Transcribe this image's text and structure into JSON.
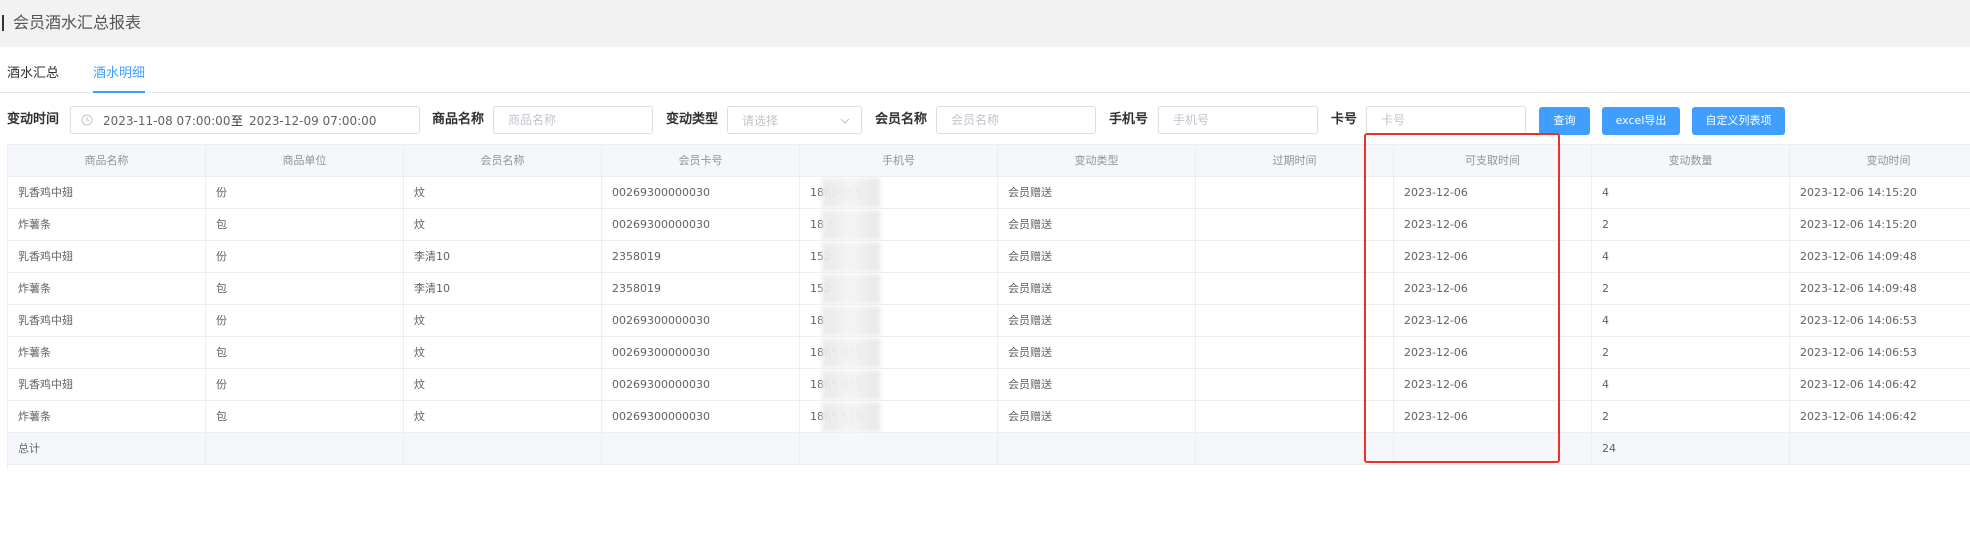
{
  "page": {
    "title": "会员酒水汇总报表"
  },
  "tabs": [
    {
      "label": "酒水汇总",
      "active": false
    },
    {
      "label": "酒水明细",
      "active": true
    }
  ],
  "filters": {
    "change_time_label": "变动时间",
    "date_start": "2023-11-08 07:00:00",
    "date_sep": "至",
    "date_end": "2023-12-09 07:00:00",
    "product_name_label": "商品名称",
    "product_name_placeholder": "商品名称",
    "change_type_label": "变动类型",
    "change_type_placeholder": "请选择",
    "member_name_label": "会员名称",
    "member_name_placeholder": "会员名称",
    "phone_label": "手机号",
    "phone_placeholder": "手机号",
    "card_label": "卡号",
    "card_placeholder": "卡号"
  },
  "buttons": {
    "query": "查询",
    "export": "excel导出",
    "custom_columns": "自定义列表项"
  },
  "table": {
    "headers": [
      "商品名称",
      "商品单位",
      "会员名称",
      "会员卡号",
      "手机号",
      "变动类型",
      "过期时间",
      "可支取时间",
      "变动数量",
      "变动时间"
    ],
    "rows": [
      [
        "乳香鸡中翅",
        "份",
        "炆",
        "00269300000030",
        "186503  5",
        "会员赠送",
        "",
        "2023-12-06",
        "4",
        "2023-12-06 14:15:20"
      ],
      [
        "炸薯条",
        "包",
        "炆",
        "00269300000030",
        "18  8",
        "会员赠送",
        "",
        "2023-12-06",
        "2",
        "2023-12-06 14:15:20"
      ],
      [
        "乳香鸡中翅",
        "份",
        "李清10",
        "2358019",
        "152",
        "会员赠送",
        "",
        "2023-12-06",
        "4",
        "2023-12-06 14:09:48"
      ],
      [
        "炸薯条",
        "包",
        "李清10",
        "2358019",
        "152",
        "会员赠送",
        "",
        "2023-12-06",
        "2",
        "2023-12-06 14:09:48"
      ],
      [
        "乳香鸡中翅",
        "份",
        "炆",
        "00269300000030",
        "18",
        "会员赠送",
        "",
        "2023-12-06",
        "4",
        "2023-12-06 14:06:53"
      ],
      [
        "炸薯条",
        "包",
        "炆",
        "00269300000030",
        "1865  851",
        "会员赠送",
        "",
        "2023-12-06",
        "2",
        "2023-12-06 14:06:53"
      ],
      [
        "乳香鸡中翅",
        "份",
        "炆",
        "00269300000030",
        "1865  851",
        "会员赠送",
        "",
        "2023-12-06",
        "4",
        "2023-12-06 14:06:42"
      ],
      [
        "炸薯条",
        "包",
        "炆",
        "00269300000030",
        "1865  510",
        "会员赠送",
        "",
        "2023-12-06",
        "2",
        "2023-12-06 14:06:42"
      ]
    ],
    "total_label": "总计",
    "total_quantity": "24"
  },
  "colors": {
    "primary": "#409eff",
    "highlight_box": "#e8332b",
    "header_bg": "#f5f7fa"
  },
  "icons": [
    "clock-icon",
    "chevron-down-icon"
  ]
}
